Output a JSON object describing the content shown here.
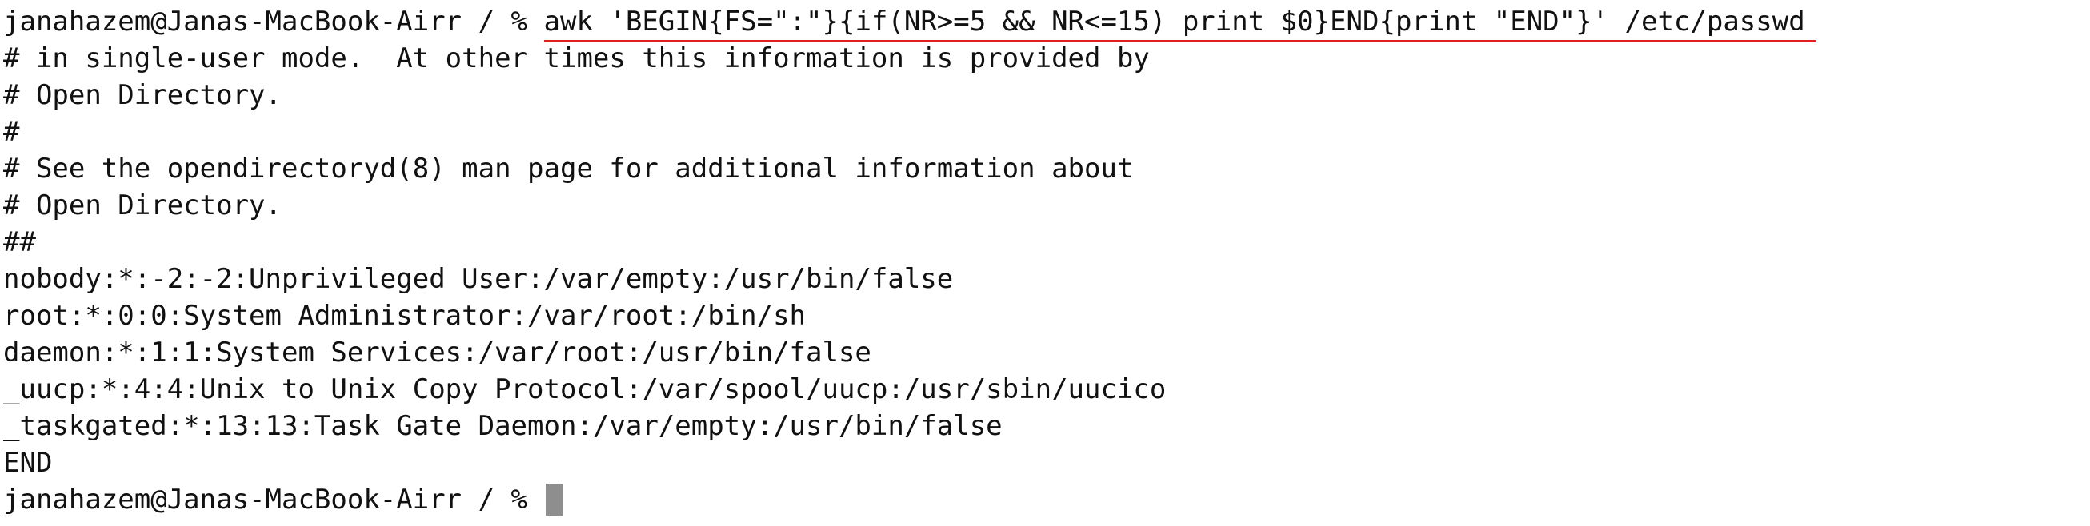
{
  "terminal": {
    "prompt": "janahazem@Janas-MacBook-Airr / % ",
    "command": "awk 'BEGIN{FS=\":\"}{if(NR>=5 && NR<=15) print $0}END{print \"END\"}' /etc/passwd",
    "output": [
      "# in single-user mode.  At other times this information is provided by",
      "# Open Directory.",
      "#",
      "# See the opendirectoryd(8) man page for additional information about",
      "# Open Directory.",
      "##",
      "nobody:*:-2:-2:Unprivileged User:/var/empty:/usr/bin/false",
      "root:*:0:0:System Administrator:/var/root:/bin/sh",
      "daemon:*:1:1:System Services:/var/root:/usr/bin/false",
      "_uucp:*:4:4:Unix to Unix Copy Protocol:/var/spool/uucp:/usr/sbin/uucico",
      "_taskgated:*:13:13:Task Gate Daemon:/var/empty:/usr/bin/false",
      "END"
    ],
    "final_prompt": "janahazem@Janas-MacBook-Airr / % ",
    "colors": {
      "background": "#ffffff",
      "text": "#111111",
      "highlight_underline": "#e0201c",
      "cursor": "#8e8e8e"
    }
  }
}
